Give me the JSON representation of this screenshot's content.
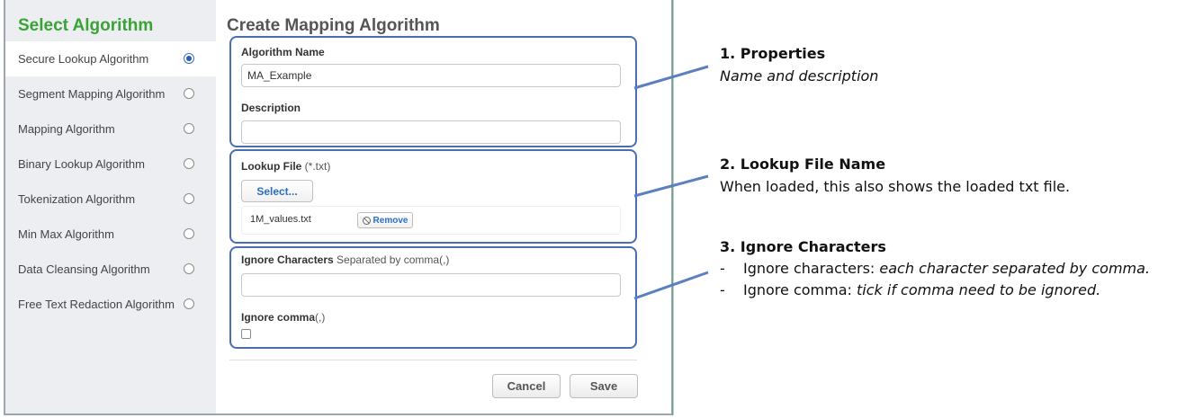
{
  "sidebar": {
    "title": "Select Algorithm",
    "items": [
      {
        "label": "Secure Lookup Algorithm",
        "selected": true
      },
      {
        "label": "Segment Mapping Algorithm",
        "selected": false
      },
      {
        "label": "Mapping Algorithm",
        "selected": false
      },
      {
        "label": "Binary Lookup Algorithm",
        "selected": false
      },
      {
        "label": "Tokenization Algorithm",
        "selected": false
      },
      {
        "label": "Min Max Algorithm",
        "selected": false
      },
      {
        "label": "Data Cleansing Algorithm",
        "selected": false
      },
      {
        "label": "Free Text Redaction Algorithm",
        "selected": false
      }
    ]
  },
  "main": {
    "title": "Create Mapping Algorithm",
    "properties": {
      "name_label": "Algorithm Name",
      "name_value": "MA_Example",
      "description_label": "Description",
      "description_value": ""
    },
    "lookup": {
      "label_bold": "Lookup File",
      "label_normal": " (*.txt)",
      "select_label": "Select...",
      "file_name": "1M_values.txt",
      "remove_label": "Remove"
    },
    "ignore": {
      "chars_label_bold": "Ignore Characters",
      "chars_label_normal": " Separated by comma(,)",
      "chars_value": "",
      "comma_label_bold": "Ignore comma",
      "comma_label_normal": "(,)",
      "comma_checked": false
    },
    "cancel_label": "Cancel",
    "save_label": "Save"
  },
  "callouts": {
    "properties": {
      "heading": "1. Properties",
      "description": "Name and description"
    },
    "lookup": {
      "heading": "2. Lookup File Name",
      "description": "When loaded, this also shows the loaded txt file."
    },
    "ignore": {
      "heading": "3. Ignore Characters",
      "bullets": [
        {
          "dash": "-",
          "plain": "Ignore characters: ",
          "italic": "each character separated by comma."
        },
        {
          "dash": "-",
          "plain": "Ignore comma: ",
          "italic": "tick if comma need to be ignored."
        }
      ]
    }
  },
  "colors": {
    "accent_green": "#3aa335",
    "callout_border": "#4a6fb0",
    "link_blue": "#2b6ec5"
  }
}
